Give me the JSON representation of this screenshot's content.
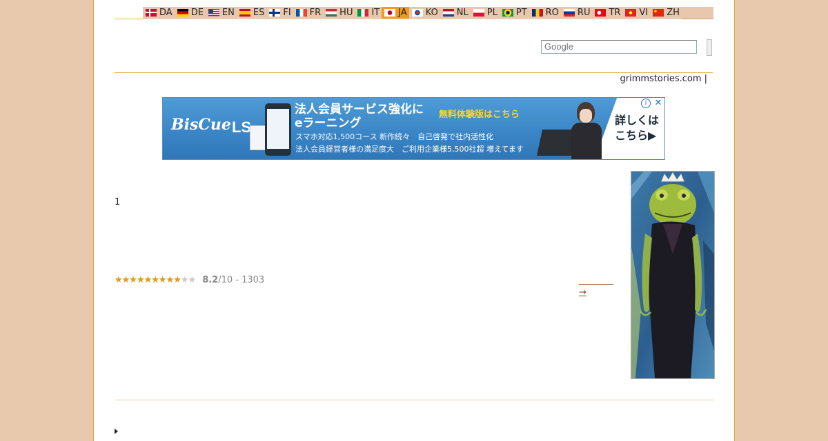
{
  "languages": [
    {
      "code": "DA",
      "flag": "dk",
      "active": false
    },
    {
      "code": "DE",
      "flag": "de",
      "active": false
    },
    {
      "code": "EN",
      "flag": "us",
      "active": false
    },
    {
      "code": "ES",
      "flag": "es",
      "active": false
    },
    {
      "code": "FI",
      "flag": "fi",
      "active": false
    },
    {
      "code": "FR",
      "flag": "fr",
      "active": false
    },
    {
      "code": "HU",
      "flag": "hu",
      "active": false
    },
    {
      "code": "IT",
      "flag": "it",
      "active": false
    },
    {
      "code": "JA",
      "flag": "jp",
      "active": true
    },
    {
      "code": "KO",
      "flag": "kr",
      "active": false
    },
    {
      "code": "NL",
      "flag": "nl",
      "active": false
    },
    {
      "code": "PL",
      "flag": "pl",
      "active": false
    },
    {
      "code": "PT",
      "flag": "br",
      "active": false
    },
    {
      "code": "RO",
      "flag": "ro",
      "active": false
    },
    {
      "code": "RU",
      "flag": "ru",
      "active": false
    },
    {
      "code": "TR",
      "flag": "tr",
      "active": false
    },
    {
      "code": "VI",
      "flag": "vn",
      "active": false
    },
    {
      "code": "ZH",
      "flag": "cn",
      "active": false
    }
  ],
  "search": {
    "placeholder": "Google"
  },
  "site": {
    "link_text": "grimmstories.com |"
  },
  "ad": {
    "brand": "BisCue",
    "brand_suffix": "LS",
    "headline_1": "法人会員サービス強化に",
    "headline_2": "eラーニング",
    "cta": "無料体験版はこちら",
    "sub_1": "スマホ対応1,500コース 新作続々　自己啓発で社内活性化",
    "sub_2": "法人会員経営者様の満足度大　ご利用企業様5,500社超 増えてます",
    "details_1": "詳しくは",
    "details_2": "こちら▶",
    "info_icon": "i",
    "close_icon": "✕"
  },
  "content": {
    "number": "1",
    "rating": {
      "score": "8.2",
      "out_of": "/10",
      "votes": " - 1303",
      "fraction": 0.82,
      "stars_total": 10
    },
    "next_link": "→"
  },
  "colors": {
    "accent": "#f39a1b",
    "background": "#e8c9ae",
    "link": "#8a3f14"
  }
}
